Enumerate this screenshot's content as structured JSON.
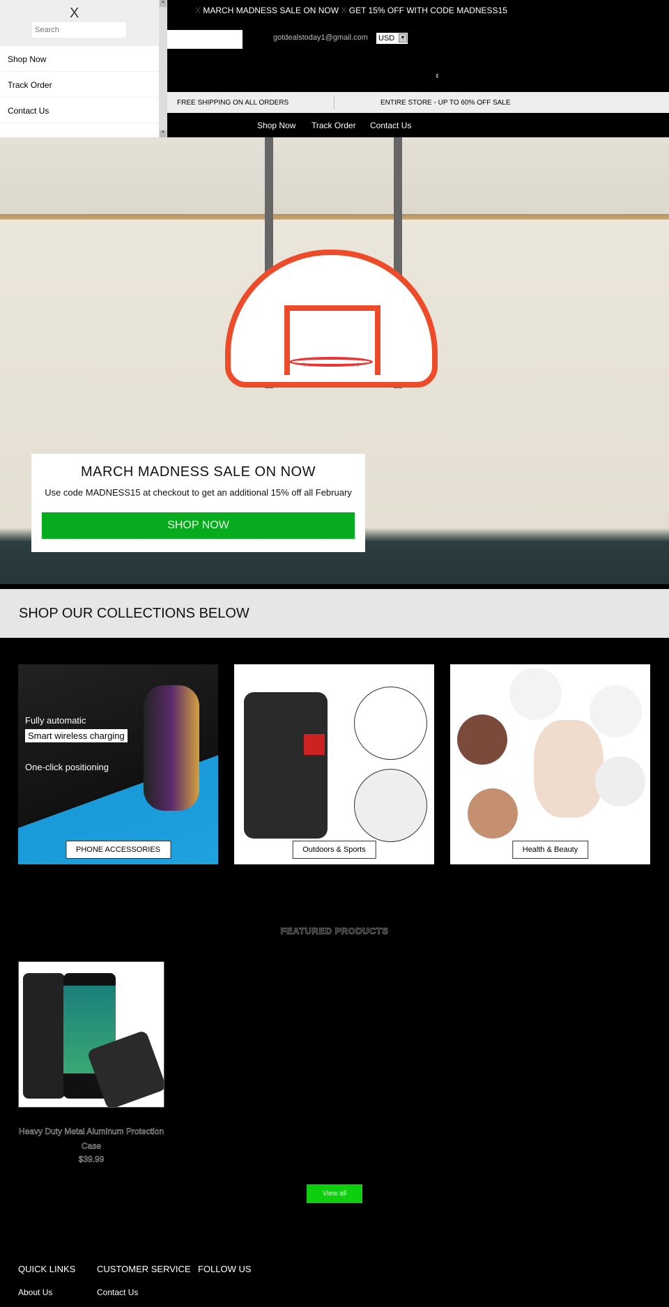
{
  "announcement": {
    "text1": "MARCH MADNESS SALE ON NOW",
    "text2": "GET 15% OFF WITH CODE MADNESS15",
    "separator": "X"
  },
  "header": {
    "email": "gotdealstoday1@gmail.com",
    "currency": "USD",
    "cart_symbol": "¢"
  },
  "promo_strip": {
    "left": "FREE SHIPPING ON ALL ORDERS",
    "right": "ENTIRE STORE - UP TO 60% OFF SALE"
  },
  "nav": {
    "items": [
      {
        "label": "Shop Now"
      },
      {
        "label": "Track Order"
      },
      {
        "label": "Contact Us"
      }
    ]
  },
  "drawer": {
    "close": "X",
    "search_placeholder": "Search",
    "items": [
      {
        "label": "Shop Now"
      },
      {
        "label": "Track Order"
      },
      {
        "label": "Contact Us"
      }
    ]
  },
  "hero": {
    "title": "MARCH MADNESS SALE ON NOW",
    "subtitle": "Use code MADNESS15 at checkout to get an additional 15% off all February",
    "button": "SHOP NOW",
    "button_color": "#06ab1e"
  },
  "collections": {
    "heading": "SHOP OUR COLLECTIONS BELOW",
    "items": [
      {
        "label": "PHONE ACCESSORIES",
        "image_text": [
          "Fully automatic",
          "Smart wireless charging",
          "One-click positioning"
        ]
      },
      {
        "label": "Outdoors & Sports"
      },
      {
        "label": "Health & Beauty"
      }
    ]
  },
  "featured": {
    "title": "FEATURED PRODUCTS",
    "products": [
      {
        "title": "Heavy Duty Metal Aluminum Protection Case",
        "price": "$39.99"
      }
    ],
    "view_all": "View all",
    "view_all_color": "#0ecf0e"
  },
  "footer": {
    "columns": [
      {
        "heading": "QUICK LINKS",
        "links": [
          "About Us"
        ]
      },
      {
        "heading": "CUSTOMER SERVICE",
        "links": [
          "Contact Us"
        ]
      },
      {
        "heading": "FOLLOW US",
        "links": []
      }
    ]
  }
}
